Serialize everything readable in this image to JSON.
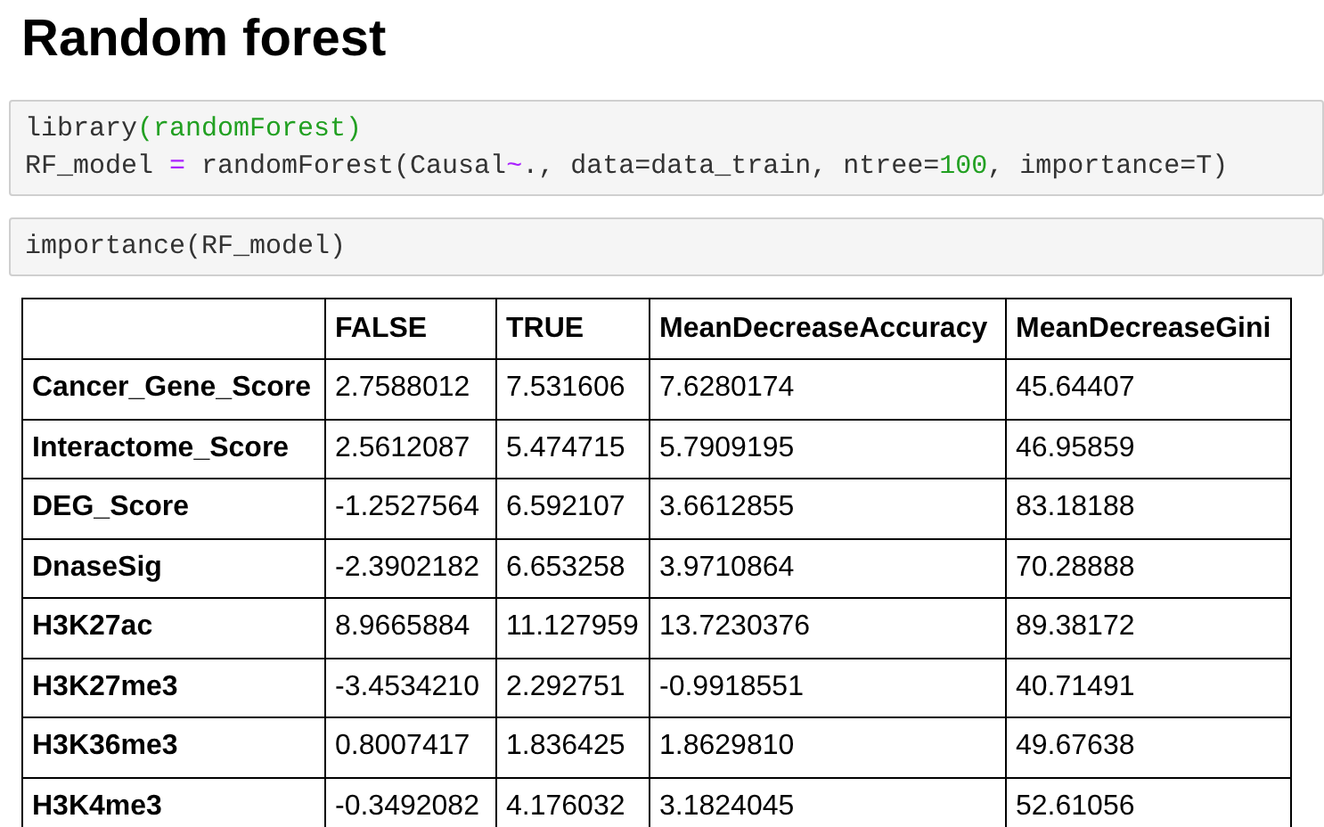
{
  "title": "Random forest",
  "cells": [
    {
      "lines": [
        [
          {
            "kind": "plain",
            "text": "library"
          },
          {
            "kind": "paren",
            "text": "(randomForest)"
          }
        ],
        [
          {
            "kind": "plain",
            "text": "RF_model "
          },
          {
            "kind": "operator",
            "text": "="
          },
          {
            "kind": "plain",
            "text": " randomForest(Causal"
          },
          {
            "kind": "operator",
            "text": "~"
          },
          {
            "kind": "plain",
            "text": "., data=data_train, ntree="
          },
          {
            "kind": "number",
            "text": "100"
          },
          {
            "kind": "plain",
            "text": ", importance=T)"
          }
        ]
      ]
    },
    {
      "lines": [
        [
          {
            "kind": "plain",
            "text": "importance(RF_model)"
          }
        ]
      ]
    }
  ],
  "table": {
    "columns": [
      "FALSE",
      "TRUE",
      "MeanDecreaseAccuracy",
      "MeanDecreaseGini"
    ],
    "rows": [
      {
        "name": "Cancer_Gene_Score",
        "values": [
          "2.7588012",
          "7.531606",
          "7.6280174",
          "45.64407"
        ]
      },
      {
        "name": "Interactome_Score",
        "values": [
          "2.5612087",
          "5.474715",
          "5.7909195",
          "46.95859"
        ]
      },
      {
        "name": "DEG_Score",
        "values": [
          "-1.2527564",
          "6.592107",
          "3.6612855",
          "83.18188"
        ]
      },
      {
        "name": "DnaseSig",
        "values": [
          "-2.3902182",
          "6.653258",
          "3.9710864",
          "70.28888"
        ]
      },
      {
        "name": "H3K27ac",
        "values": [
          "8.9665884",
          "11.127959",
          "13.7230376",
          "89.38172"
        ]
      },
      {
        "name": "H3K27me3",
        "values": [
          "-3.4534210",
          "2.292751",
          "-0.9918551",
          "40.71491"
        ]
      },
      {
        "name": "H3K36me3",
        "values": [
          "0.8007417",
          "1.836425",
          "1.8629810",
          "49.67638"
        ]
      },
      {
        "name": "H3K4me3",
        "values": [
          "-0.3492082",
          "4.176032",
          "3.1824045",
          "52.61056"
        ]
      }
    ]
  }
}
